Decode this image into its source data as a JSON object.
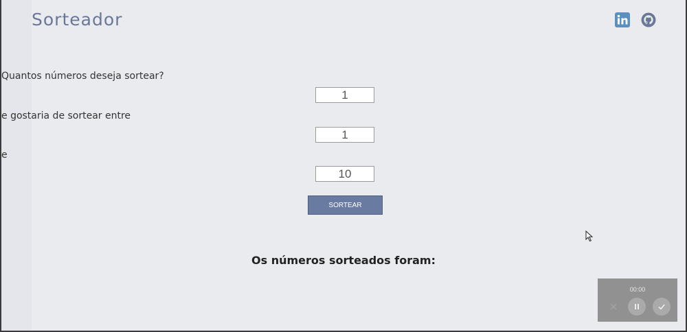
{
  "header": {
    "title": "Sorteador",
    "social": [
      {
        "name": "linkedin-icon",
        "color": "#5a8fc0"
      },
      {
        "name": "github-icon",
        "color": "#6a7898"
      }
    ]
  },
  "form": {
    "question_label": "Quantos números deseja sortear?",
    "quantity_value": "1",
    "range_label": "e gostaria de sortear entre",
    "min_value": "1",
    "and_label": "e",
    "max_value": "10",
    "submit_label": "SORTEAR"
  },
  "result": {
    "title": "Os números sorteados foram:"
  },
  "recorder": {
    "timer": "00:00",
    "buttons": [
      "close-icon",
      "pause-icon",
      "check-icon"
    ]
  },
  "colors": {
    "accent": "#6a7ba1",
    "background": "#e9ebef",
    "title": "#6a7898"
  }
}
